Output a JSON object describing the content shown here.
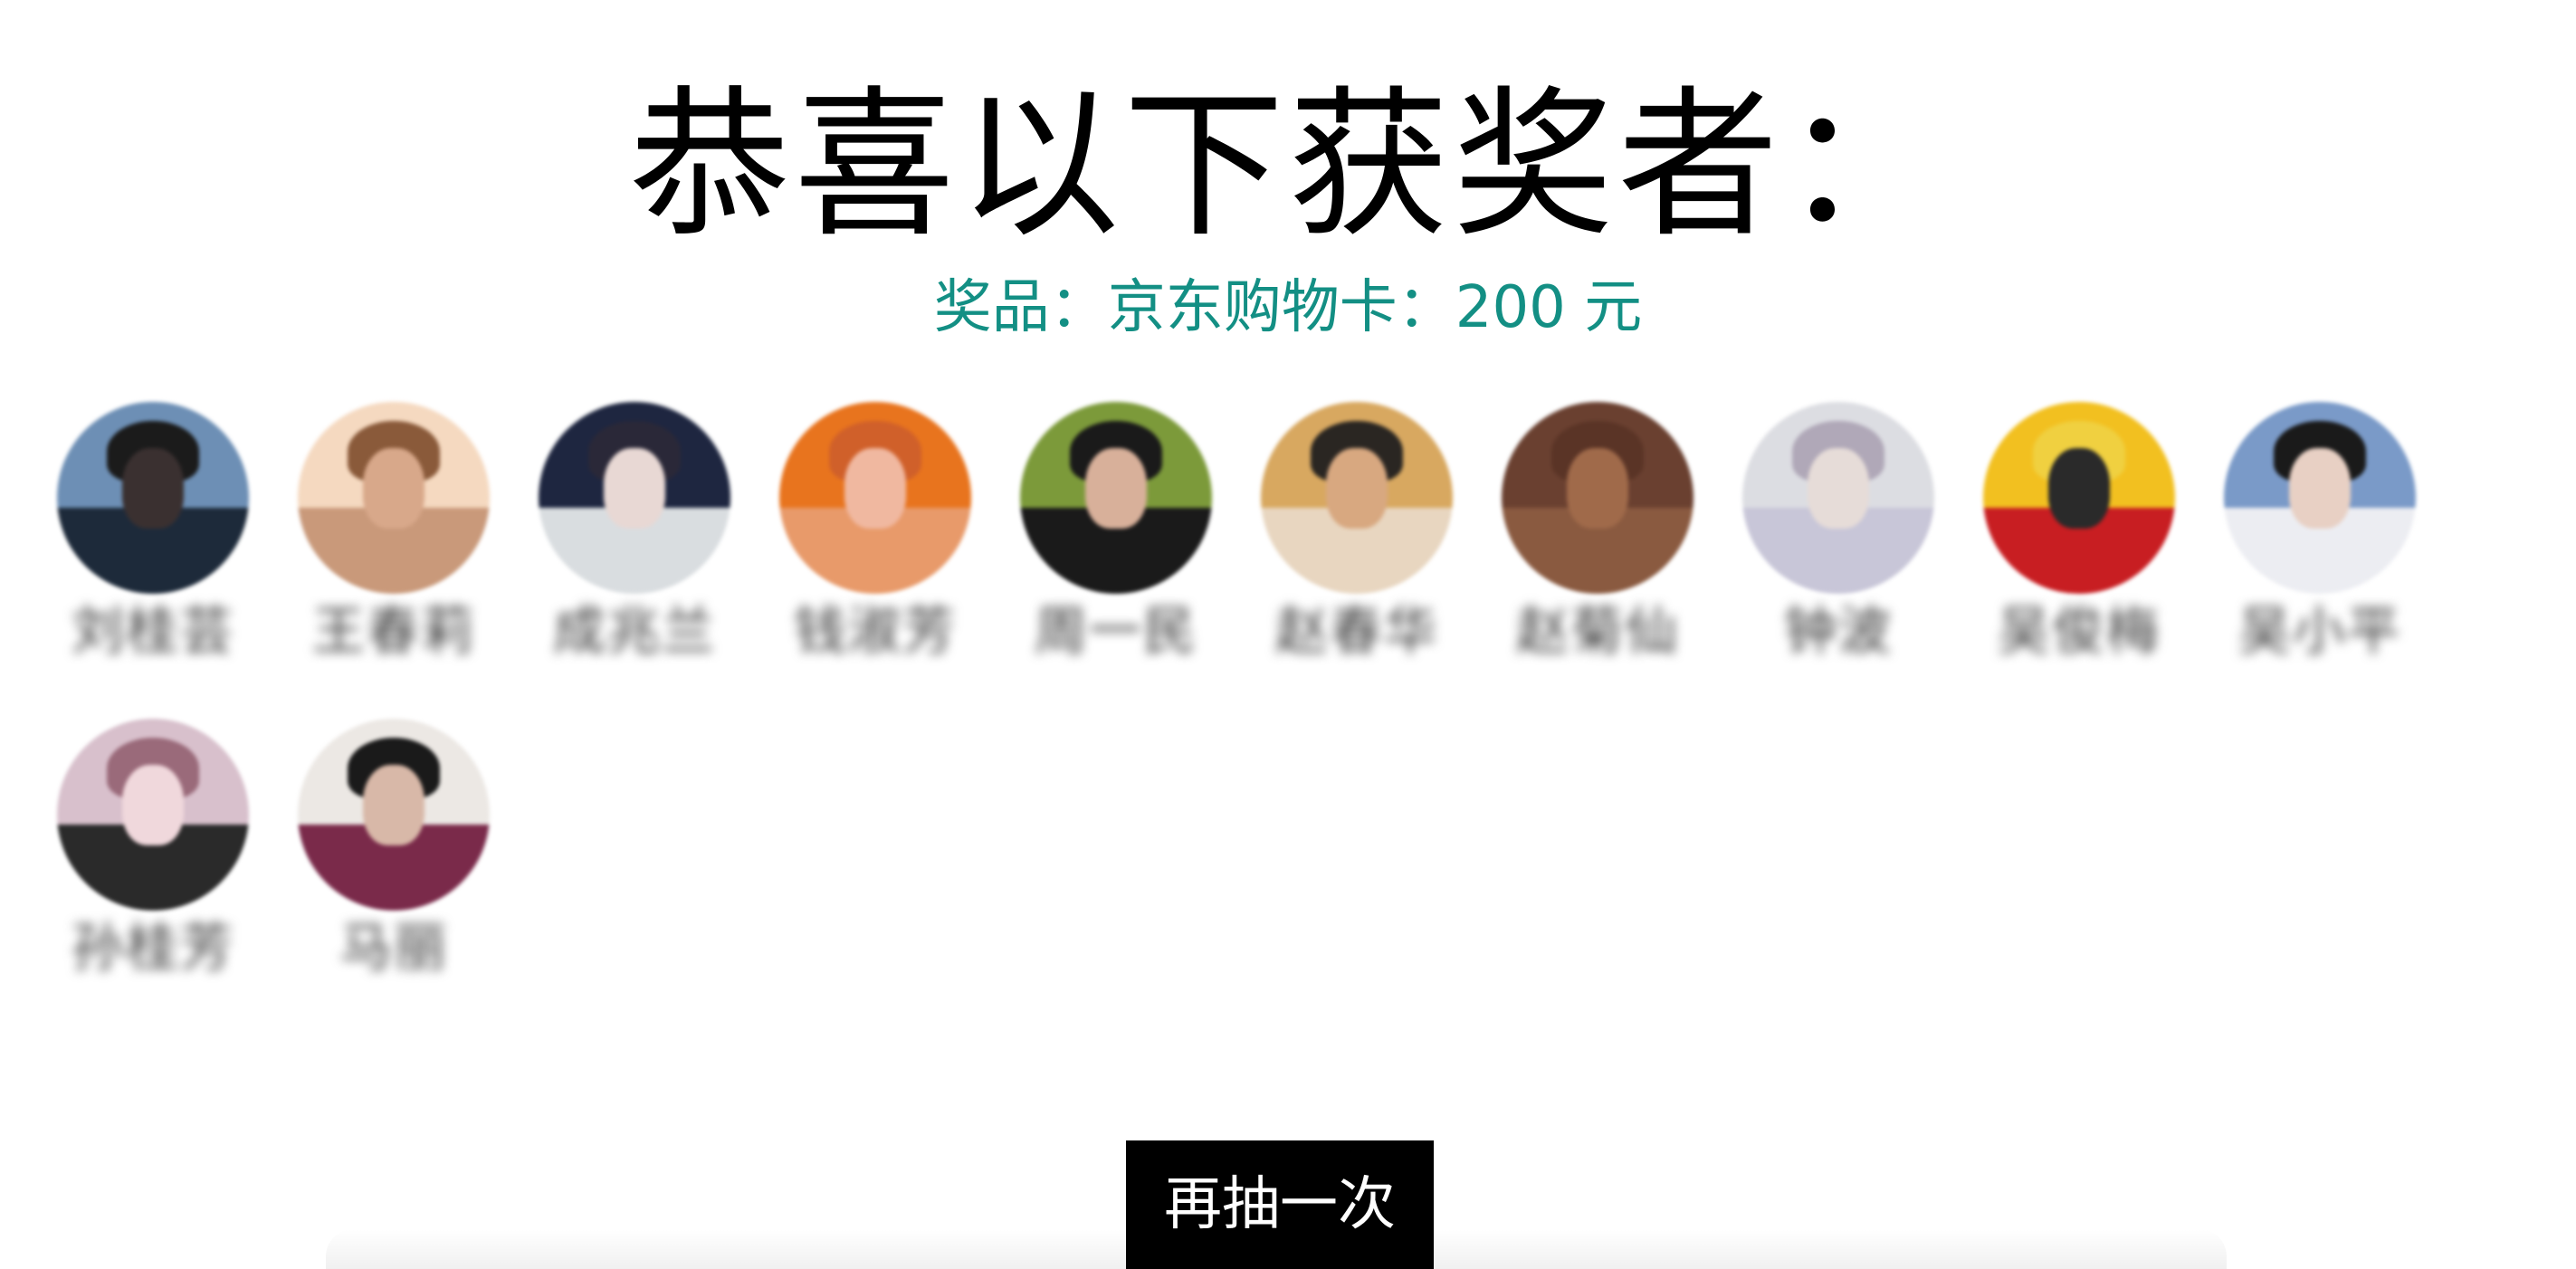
{
  "title": "恭喜以下获奖者：",
  "prize_text": "奖品：京东购物卡：200 元",
  "winners": [
    {
      "name": "刘桂芸",
      "avatar": {
        "top": "#6d8fb5",
        "bottom": "#1d2a3a",
        "face": "#3a3030",
        "hair": "#1b1b1b"
      }
    },
    {
      "name": "王春莉",
      "avatar": {
        "top": "#f5d9c0",
        "bottom": "#c9997a",
        "face": "#d8a88a",
        "hair": "#8a5a3a"
      }
    },
    {
      "name": "成兆兰",
      "avatar": {
        "top": "#1e2640",
        "bottom": "#d9dde0",
        "face": "#e8d8d4",
        "hair": "#2a2838"
      }
    },
    {
      "name": "钱淑芳",
      "avatar": {
        "top": "#e8741e",
        "bottom": "#e89a6a",
        "face": "#f0b8a0",
        "hair": "#d0602a"
      }
    },
    {
      "name": "周一民",
      "avatar": {
        "top": "#7c9a3a",
        "bottom": "#1a1a1a",
        "face": "#d8b09a",
        "hair": "#1a1a1a"
      }
    },
    {
      "name": "赵春华",
      "avatar": {
        "top": "#d8a860",
        "bottom": "#e8d6c0",
        "face": "#d8a880",
        "hair": "#2a2622"
      }
    },
    {
      "name": "赵菊仙",
      "avatar": {
        "top": "#6a4030",
        "bottom": "#8a5a40",
        "face": "#a06a4a",
        "hair": "#5a3426"
      }
    },
    {
      "name": "钟波",
      "avatar": {
        "top": "#dcdde2",
        "bottom": "#c8c6d8",
        "face": "#e6dcd8",
        "hair": "#b0a8b8"
      }
    },
    {
      "name": "吴俊梅",
      "avatar": {
        "top": "#f2c020",
        "bottom": "#c81e22",
        "face": "#2a2a2a",
        "hair": "#f0d040"
      }
    },
    {
      "name": "吴小平",
      "avatar": {
        "top": "#7a9ac8",
        "bottom": "#ecedf2",
        "face": "#e8d0c4",
        "hair": "#1a1a1a"
      }
    },
    {
      "name": "孙桂芳",
      "avatar": {
        "top": "#d8c0cc",
        "bottom": "#2a2a2a",
        "face": "#f0d8dc",
        "hair": "#9a6a7a"
      }
    },
    {
      "name": "马丽",
      "avatar": {
        "top": "#ece8e4",
        "bottom": "#7a2a4a",
        "face": "#d8b8a8",
        "hair": "#1a1a1a"
      }
    }
  ],
  "redraw_button": "再抽一次",
  "colors": {
    "prize_text": "#138f84",
    "button_bg": "#000000",
    "button_text": "#ffffff"
  }
}
